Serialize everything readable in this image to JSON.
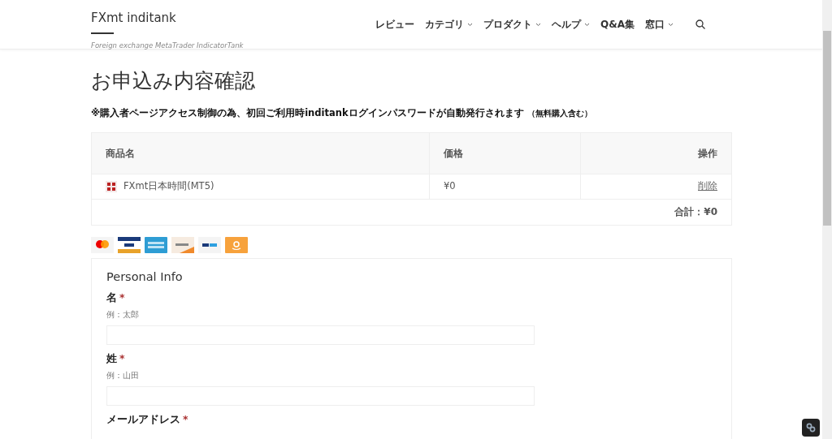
{
  "site": {
    "title": "FXmt inditank",
    "tagline": "Foreign exchange MetaTrader IndicatorTank"
  },
  "nav": [
    {
      "label": "レビュー",
      "dropdown": false
    },
    {
      "label": "カテゴリ",
      "dropdown": true
    },
    {
      "label": "プロダクト",
      "dropdown": true
    },
    {
      "label": "ヘルプ",
      "dropdown": true
    },
    {
      "label": "Q&A集",
      "dropdown": false
    },
    {
      "label": "窓口",
      "dropdown": true
    }
  ],
  "page_title": "お申込み内容確認",
  "notice": "※購入者ページアクセス制御の為、初回ご利用時inditankログインパスワードが自動発行されます",
  "notice_small": "（無料購入含む）",
  "table": {
    "columns": [
      "商品名",
      "価格",
      "操作"
    ],
    "rows": [
      {
        "product": "FXmt日本時間(MT5)",
        "price": "¥0",
        "action": "削除"
      }
    ],
    "total": "合計：¥0"
  },
  "payment_logos": [
    {
      "kind": "mastercard"
    },
    {
      "kind": "visa"
    },
    {
      "kind": "amex"
    },
    {
      "kind": "discover"
    },
    {
      "kind": "paypal"
    },
    {
      "kind": "amazon"
    }
  ],
  "form": {
    "heading": "Personal Info",
    "fields": [
      {
        "label": "名",
        "required_mark": "*",
        "hint": "例：太郎"
      },
      {
        "label": "姓",
        "required_mark": "*",
        "hint": "例：山田"
      },
      {
        "label": "メールアドレス",
        "required_mark": "*"
      }
    ]
  }
}
